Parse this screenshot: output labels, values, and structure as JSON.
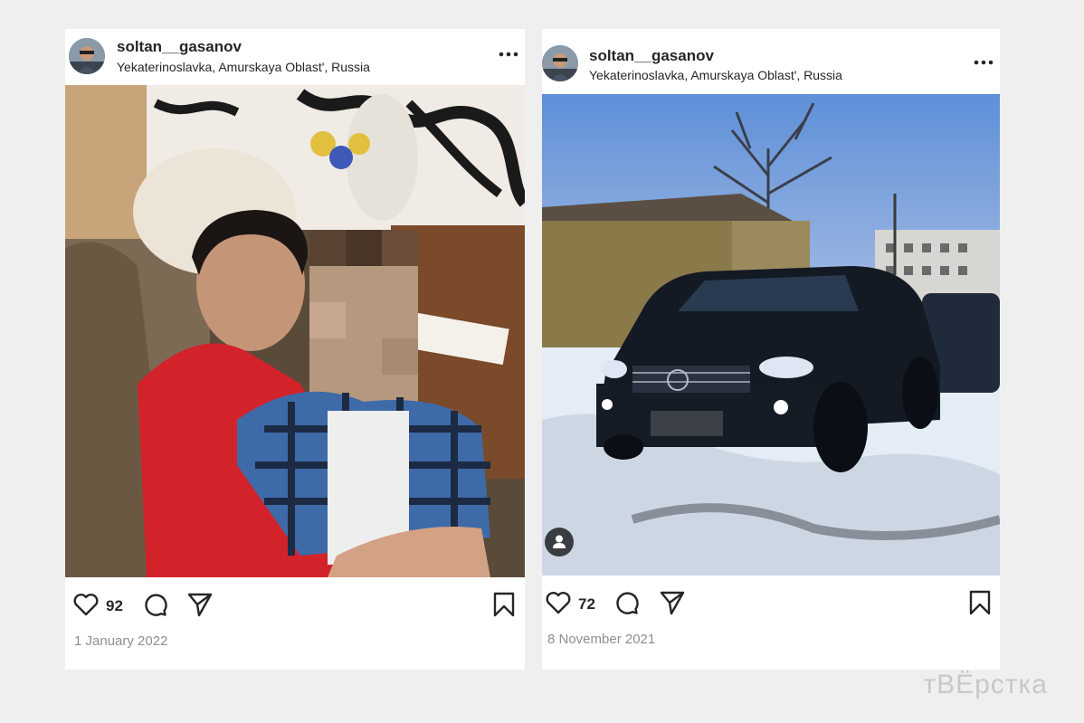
{
  "posts": [
    {
      "username": "soltan__gasanov",
      "location": "Yekaterinoslavka, Amurskaya Oblast', Russia",
      "likes": "92",
      "date": "1 January 2022",
      "icons": [
        "heart-icon",
        "comment-icon",
        "share-icon",
        "bookmark-icon",
        "more-options-icon"
      ]
    },
    {
      "username": "soltan__gasanov",
      "location": "Yekaterinoslavka, Amurskaya Oblast', Russia",
      "likes": "72",
      "date": "8 November 2021",
      "icons": [
        "heart-icon",
        "comment-icon",
        "share-icon",
        "bookmark-icon",
        "more-options-icon",
        "user-tag-icon"
      ]
    }
  ],
  "watermark": "тВЁрстка",
  "colors": {
    "background": "#efefef",
    "card": "#ffffff",
    "text": "#262626",
    "muted": "#8e8e8e"
  }
}
